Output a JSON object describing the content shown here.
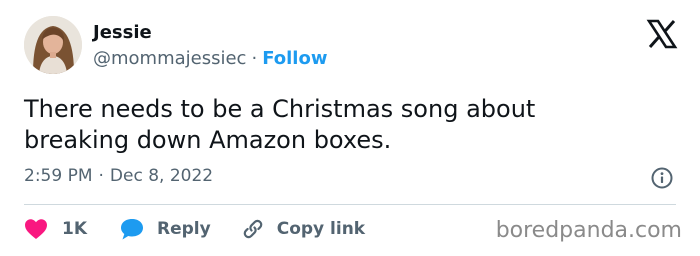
{
  "author": {
    "name": "Jessie",
    "handle": "@mommajessiec",
    "separator": "·",
    "follow_label": "Follow"
  },
  "icons": {
    "brand": "x-logo-icon",
    "info": "info-icon",
    "like": "heart-icon",
    "reply": "speech-bubble-icon",
    "copy": "link-icon"
  },
  "tweet": {
    "text": "There needs to be a Christmas song about\nbreaking down Amazon boxes.",
    "time": "2:59 PM",
    "separator": "·",
    "date": "Dec 8, 2022"
  },
  "actions": {
    "likes_count": "1K",
    "reply_label": "Reply",
    "copy_link_label": "Copy link"
  },
  "watermark": "boredpanda.com",
  "colors": {
    "follow": "#1d9bf0",
    "heart": "#f91880",
    "reply_bubble": "#1d9bf0",
    "secondary_text": "#536471",
    "divider": "#cfd9de"
  }
}
